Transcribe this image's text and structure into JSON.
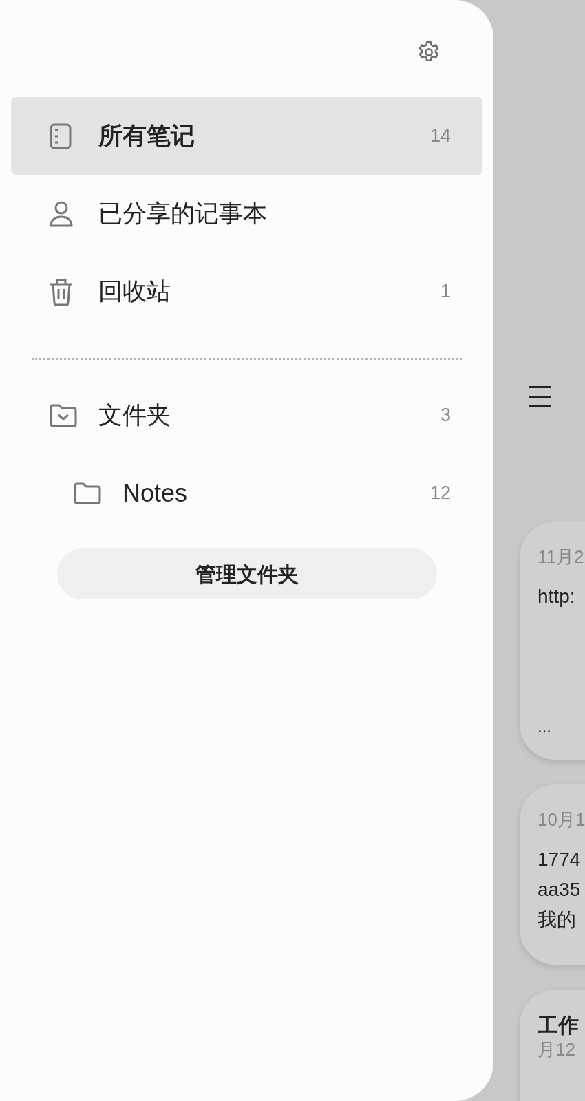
{
  "drawer": {
    "items": [
      {
        "kind": "notebook",
        "label": "所有笔记",
        "count": "14",
        "selected": true
      },
      {
        "kind": "person",
        "label": "已分享的记事本",
        "selected": false
      },
      {
        "kind": "trash",
        "label": "回收站",
        "count": "1",
        "selected": false
      }
    ],
    "folders": [
      {
        "kind": "folder-root",
        "label": "文件夹",
        "count": "3",
        "selected": false,
        "children": [
          {
            "kind": "folder",
            "label": "Notes",
            "count": "12",
            "selected": false
          }
        ]
      }
    ],
    "manage_button": "管理文件夹"
  },
  "notes": [
    {
      "date": "11月2",
      "lines": [
        "http:"
      ],
      "more": "..."
    },
    {
      "date": "10月1",
      "lines": [
        "1774",
        "aa35",
        "我的"
      ]
    },
    {
      "title": "工作",
      "date": "月12"
    }
  ]
}
